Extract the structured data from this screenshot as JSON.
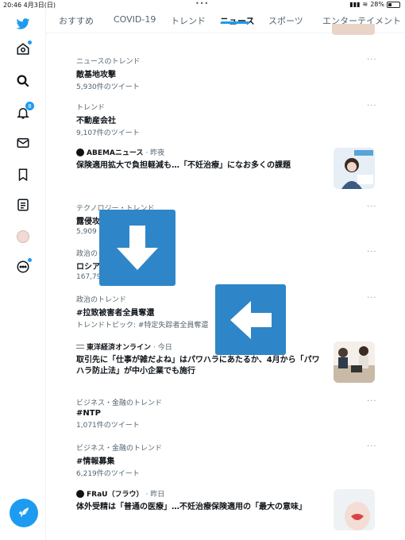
{
  "status": {
    "time": "20:46",
    "date": "4月3日(日)",
    "battery": "28%",
    "battery_level": 0.28
  },
  "sidebar": {
    "notification_count": "8"
  },
  "tabs": [
    {
      "label": "おすすめ"
    },
    {
      "label": "COVID-19"
    },
    {
      "label": "トレンド"
    },
    {
      "label": "ニュース",
      "active": true
    },
    {
      "label": "スポーツ"
    },
    {
      "label": "エンターテイメント"
    }
  ],
  "feed": [
    {
      "meta": "ニュースのトレンド",
      "title": "敵基地攻撃",
      "sub": "5,930件のツイート"
    },
    {
      "meta": "トレンド",
      "title": "不動産会社",
      "sub": "9,107件のツイート"
    },
    {
      "source": "ABEMAニュース",
      "when": "· 昨夜",
      "title": "保険適用拡大で負担軽減も…「不妊治療」になお多くの課題"
    },
    {
      "meta": "テクノロジー・トレンド",
      "title": "露侵攻",
      "sub": "5,909"
    },
    {
      "meta": "政治の",
      "title": "ロシア",
      "sub": "167,792"
    },
    {
      "meta": "政治のトレンド",
      "title": "#拉致被害者全員奪還",
      "sub": "トレンドトピック: #特定失踪者全員奪還"
    },
    {
      "source": "東洋経済オンライン",
      "when": "· 今日",
      "title": "取引先に「仕事が雑だよね」はパワハラにあたるか、4月から「パワハラ防止法」が中小企業でも施行"
    },
    {
      "meta": "ビジネス・金融のトレンド",
      "title": "#NTP",
      "sub": "1,071件のツイート"
    },
    {
      "meta": "ビジネス・金融のトレンド",
      "title": "#情報募集",
      "sub": "6,219件のツイート"
    },
    {
      "source": "FRaU（フラウ）",
      "when": "· 昨日",
      "title": "体外受精は「普通の医療」…不妊治療保険適用の「最大の意味」"
    }
  ],
  "more_label": "···",
  "colors": {
    "accent": "#1d9bf0",
    "overlay_arrow": "#2e86c8"
  },
  "overlay_arrows": [
    {
      "name": "down-arrow-icon"
    },
    {
      "name": "left-arrow-icon"
    }
  ]
}
